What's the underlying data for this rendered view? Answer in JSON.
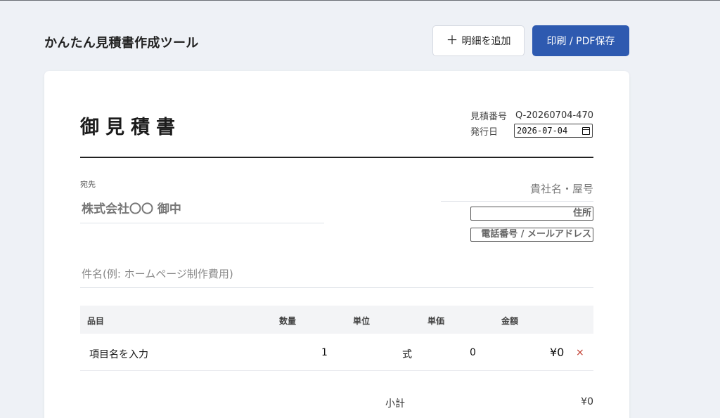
{
  "app": {
    "title": "かんたん見積書作成ツール",
    "add_button": "明細を追加",
    "print_button": "印刷 / PDF保存"
  },
  "document": {
    "title": "御見積書",
    "quote_number_label": "見積番号",
    "quote_number": "Q-20260704-470",
    "issue_date_label": "発行日",
    "issue_date": "2026-07-04",
    "recipient_label": "宛先",
    "recipient_name": "株式会社〇〇 御中",
    "company_name_placeholder": "貴社名・屋号",
    "address_placeholder": "住所",
    "contact_placeholder": "電話番号 / メールアドレス",
    "subject_placeholder": "件名(例: ホームページ制作費用)"
  },
  "table": {
    "headers": [
      "品目",
      "数量",
      "単位",
      "単価",
      "金額"
    ],
    "rows": [
      {
        "item": "項目名を入力",
        "qty": "1",
        "unit": "式",
        "price": "0",
        "amount": "¥0",
        "delete": "×"
      }
    ]
  },
  "totals": {
    "subtotal_label": "小計",
    "subtotal_value": "¥0"
  },
  "colors": {
    "background": "#eef1f6",
    "primary_button": "#2e5ab0",
    "delete": "#c0392b"
  }
}
